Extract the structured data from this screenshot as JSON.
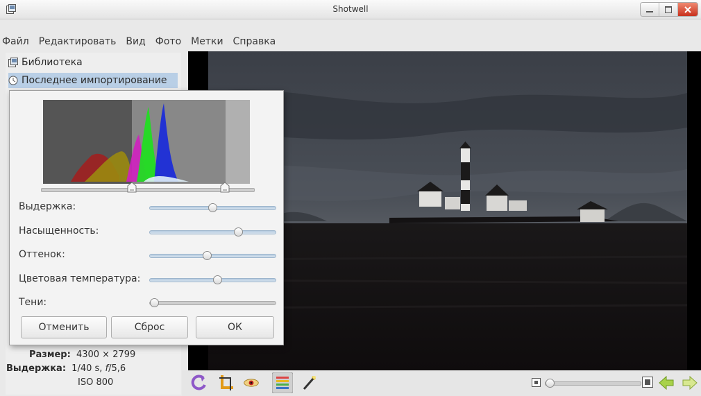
{
  "window": {
    "title": "Shotwell"
  },
  "menu": [
    "Файл",
    "Редактировать",
    "Вид",
    "Фото",
    "Метки",
    "Справка"
  ],
  "sidebar": {
    "items": [
      {
        "label": "Библиотека",
        "icon": "library-icon",
        "selected": false
      },
      {
        "label": "Последнее импортирование",
        "icon": "clock-icon",
        "selected": true
      }
    ]
  },
  "properties": {
    "size_label": "Размер:",
    "size_value": "4300 × 2799",
    "exposure_label": "Выдержка:",
    "exposure_value": "1/40 s, f/5,6",
    "exposure_value_prefix": "1/40 s, ",
    "exposure_value_fnumber": "f",
    "exposure_value_suffix": "/5,6",
    "iso_value": "ISO 800"
  },
  "adjust_dialog": {
    "sliders": [
      {
        "label": "Выдержка:",
        "value": 0.5
      },
      {
        "label": "Насыщенность:",
        "value": 0.72
      },
      {
        "label": "Оттенок:",
        "value": 0.45
      },
      {
        "label": "Цветовая температура:",
        "value": 0.54
      },
      {
        "label": "Тени:",
        "value": 0.0
      }
    ],
    "buttons": {
      "cancel": "Отменить",
      "reset": "Сброс",
      "ok": "ОК"
    }
  },
  "toolbar": {
    "tools": [
      "rotate-icon",
      "crop-icon",
      "redeye-icon",
      "adjust-icon",
      "enhance-icon"
    ],
    "zoom_level": 0.0
  },
  "colors": {
    "selection": "#b9cfe6",
    "close_button": "#d6452b",
    "nav_arrows": "#9ccc3c"
  }
}
